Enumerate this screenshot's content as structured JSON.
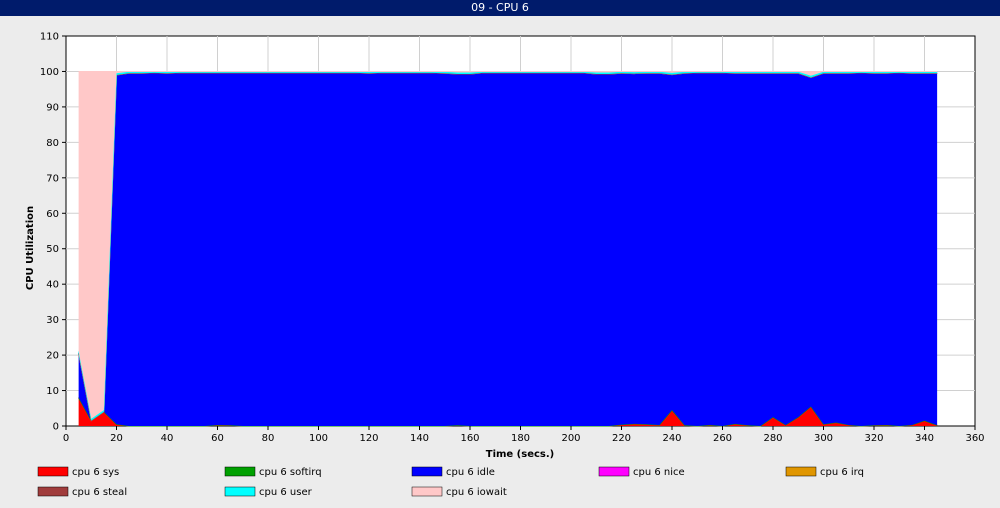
{
  "window": {
    "title": "09 - CPU 6"
  },
  "chart_data": {
    "type": "area",
    "stacked": true,
    "title": "09 - CPU 6",
    "xlabel": "Time (secs.)",
    "ylabel": "CPU Utilization",
    "xlim": [
      0,
      360
    ],
    "ylim": [
      0,
      110
    ],
    "xticks": [
      0,
      20,
      40,
      60,
      80,
      100,
      120,
      140,
      160,
      180,
      200,
      220,
      240,
      260,
      280,
      300,
      320,
      340,
      360
    ],
    "yticks": [
      0,
      10,
      20,
      30,
      40,
      50,
      60,
      70,
      80,
      90,
      100,
      110
    ],
    "grid": true,
    "legend_position": "bottom",
    "x": [
      5,
      10,
      15,
      20,
      25,
      30,
      35,
      40,
      45,
      50,
      55,
      60,
      65,
      70,
      75,
      80,
      85,
      90,
      95,
      100,
      105,
      110,
      115,
      120,
      125,
      130,
      135,
      140,
      145,
      150,
      155,
      160,
      165,
      170,
      175,
      180,
      185,
      190,
      195,
      200,
      205,
      210,
      215,
      220,
      225,
      230,
      235,
      240,
      245,
      250,
      255,
      260,
      265,
      270,
      275,
      280,
      285,
      290,
      295,
      300,
      305,
      310,
      315,
      320,
      325,
      330,
      335,
      340,
      345
    ],
    "series": [
      {
        "name": "cpu 6 sys",
        "color": "#ff0000",
        "values": [
          8,
          1.5,
          4,
          0.5,
          0,
          0,
          0,
          0,
          0,
          0,
          0,
          0.3,
          0.2,
          0,
          0,
          0,
          0,
          0,
          0,
          0,
          0,
          0,
          0,
          0,
          0,
          0,
          0,
          0,
          0,
          0,
          0.2,
          0,
          0,
          0,
          0,
          0,
          0,
          0,
          0,
          0,
          0,
          0,
          0,
          0.4,
          0.6,
          0.5,
          0.3,
          4.5,
          0.2,
          0,
          0.3,
          0,
          0.6,
          0.2,
          0,
          2.5,
          0.3,
          2.5,
          5.5,
          0.5,
          1,
          0.3,
          0,
          0.2,
          0.3,
          0,
          0.3,
          1.5,
          0.2
        ]
      },
      {
        "name": "cpu 6 softirq",
        "color": "#00a000",
        "values": [
          0,
          0,
          0,
          0,
          0,
          0,
          0,
          0,
          0,
          0,
          0,
          0,
          0,
          0,
          0,
          0,
          0,
          0,
          0,
          0,
          0,
          0,
          0,
          0,
          0,
          0,
          0,
          0,
          0,
          0,
          0,
          0,
          0,
          0,
          0,
          0,
          0,
          0,
          0,
          0,
          0,
          0,
          0,
          0,
          0,
          0,
          0,
          0,
          0,
          0,
          0,
          0,
          0,
          0,
          0,
          0,
          0,
          0,
          0,
          0,
          0,
          0,
          0,
          0,
          0,
          0,
          0,
          0,
          0
        ]
      },
      {
        "name": "cpu 6 idle",
        "color": "#0000ff",
        "values": [
          12.5,
          0,
          0,
          98.5,
          99.5,
          99.5,
          99.6,
          99.5,
          99.6,
          99.6,
          99.6,
          99.3,
          99.4,
          99.6,
          99.6,
          99.6,
          99.6,
          99.6,
          99.6,
          99.6,
          99.6,
          99.6,
          99.6,
          99.5,
          99.6,
          99.6,
          99.6,
          99.6,
          99.6,
          99.5,
          99.1,
          99.3,
          99.6,
          99.6,
          99.6,
          99.6,
          99.6,
          99.6,
          99.6,
          99.6,
          99.6,
          99.3,
          99.3,
          99.1,
          98.8,
          99.0,
          99.2,
          94.6,
          99.3,
          99.6,
          99.3,
          99.6,
          98.9,
          99.3,
          99.5,
          97.0,
          99.2,
          97.0,
          92.8,
          99.0,
          98.5,
          99.2,
          99.6,
          99.3,
          99.2,
          99.6,
          99.2,
          98.0,
          99.3
        ]
      },
      {
        "name": "cpu 6 nice",
        "color": "#ff00ff",
        "values": [
          0,
          0,
          0,
          0,
          0,
          0,
          0,
          0,
          0,
          0,
          0,
          0,
          0,
          0,
          0,
          0,
          0,
          0,
          0,
          0,
          0,
          0,
          0,
          0,
          0,
          0,
          0,
          0,
          0,
          0,
          0,
          0,
          0,
          0,
          0,
          0,
          0,
          0,
          0,
          0,
          0,
          0,
          0,
          0,
          0,
          0,
          0,
          0,
          0,
          0,
          0,
          0,
          0,
          0,
          0,
          0,
          0,
          0,
          0,
          0,
          0,
          0,
          0,
          0,
          0,
          0,
          0,
          0,
          0
        ]
      },
      {
        "name": "cpu 6 irq",
        "color": "#e09600",
        "values": [
          0,
          0,
          0,
          0,
          0,
          0,
          0,
          0,
          0,
          0,
          0,
          0,
          0,
          0,
          0,
          0,
          0,
          0,
          0,
          0,
          0,
          0,
          0,
          0,
          0,
          0,
          0,
          0,
          0,
          0,
          0,
          0,
          0,
          0,
          0,
          0,
          0,
          0,
          0,
          0,
          0,
          0,
          0,
          0,
          0,
          0,
          0,
          0,
          0,
          0,
          0,
          0,
          0,
          0,
          0,
          0,
          0,
          0,
          0,
          0,
          0,
          0,
          0,
          0,
          0,
          0,
          0,
          0,
          0
        ]
      },
      {
        "name": "cpu 6 steal",
        "color": "#a03c3c",
        "values": [
          0,
          0,
          0,
          0,
          0,
          0,
          0,
          0,
          0,
          0,
          0,
          0,
          0,
          0,
          0,
          0,
          0,
          0,
          0,
          0,
          0,
          0,
          0,
          0,
          0,
          0,
          0,
          0,
          0,
          0,
          0,
          0,
          0,
          0,
          0,
          0,
          0,
          0,
          0,
          0,
          0,
          0,
          0,
          0,
          0,
          0,
          0,
          0,
          0,
          0,
          0,
          0,
          0,
          0,
          0,
          0,
          0,
          0,
          0,
          0,
          0,
          0,
          0,
          0,
          0,
          0,
          0,
          0,
          0
        ]
      },
      {
        "name": "cpu 6 user",
        "color": "#00ffff",
        "values": [
          0.5,
          0.5,
          0.5,
          0.5,
          0.4,
          0.4,
          0.3,
          0.4,
          0.3,
          0.3,
          0.3,
          0.3,
          0.3,
          0.3,
          0.3,
          0.3,
          0.3,
          0.3,
          0.3,
          0.3,
          0.3,
          0.3,
          0.3,
          0.4,
          0.3,
          0.3,
          0.3,
          0.3,
          0.3,
          0.4,
          0.4,
          0.4,
          0.3,
          0.3,
          0.3,
          0.3,
          0.3,
          0.3,
          0.3,
          0.3,
          0.3,
          0.4,
          0.4,
          0.4,
          0.4,
          0.4,
          0.4,
          0.5,
          0.4,
          0.3,
          0.3,
          0.3,
          0.4,
          0.4,
          0.4,
          0.4,
          0.4,
          0.4,
          0.5,
          0.4,
          0.4,
          0.4,
          0.3,
          0.4,
          0.4,
          0.3,
          0.4,
          0.4,
          0.4
        ]
      },
      {
        "name": "cpu 6 iowait",
        "color": "#ffc8c8",
        "values": [
          79,
          98,
          95.5,
          0.5,
          0.1,
          0.1,
          0.1,
          0.1,
          0.1,
          0.1,
          0.1,
          0.1,
          0.1,
          0.1,
          0.1,
          0.1,
          0.1,
          0.1,
          0.1,
          0.1,
          0.1,
          0.1,
          0.1,
          0.1,
          0.1,
          0.1,
          0.1,
          0.1,
          0.1,
          0.1,
          0.3,
          0.3,
          0.1,
          0.1,
          0.1,
          0.1,
          0.1,
          0.1,
          0.1,
          0.1,
          0.1,
          0.3,
          0.3,
          0.1,
          0.2,
          0.1,
          0.1,
          0.4,
          0.1,
          0.1,
          0.1,
          0.1,
          0.1,
          0.1,
          0.1,
          0.1,
          0.1,
          0.1,
          1.2,
          0.1,
          0.1,
          0.1,
          0.1,
          0.1,
          0.1,
          0.1,
          0.1,
          0.1,
          0.1
        ]
      }
    ]
  }
}
